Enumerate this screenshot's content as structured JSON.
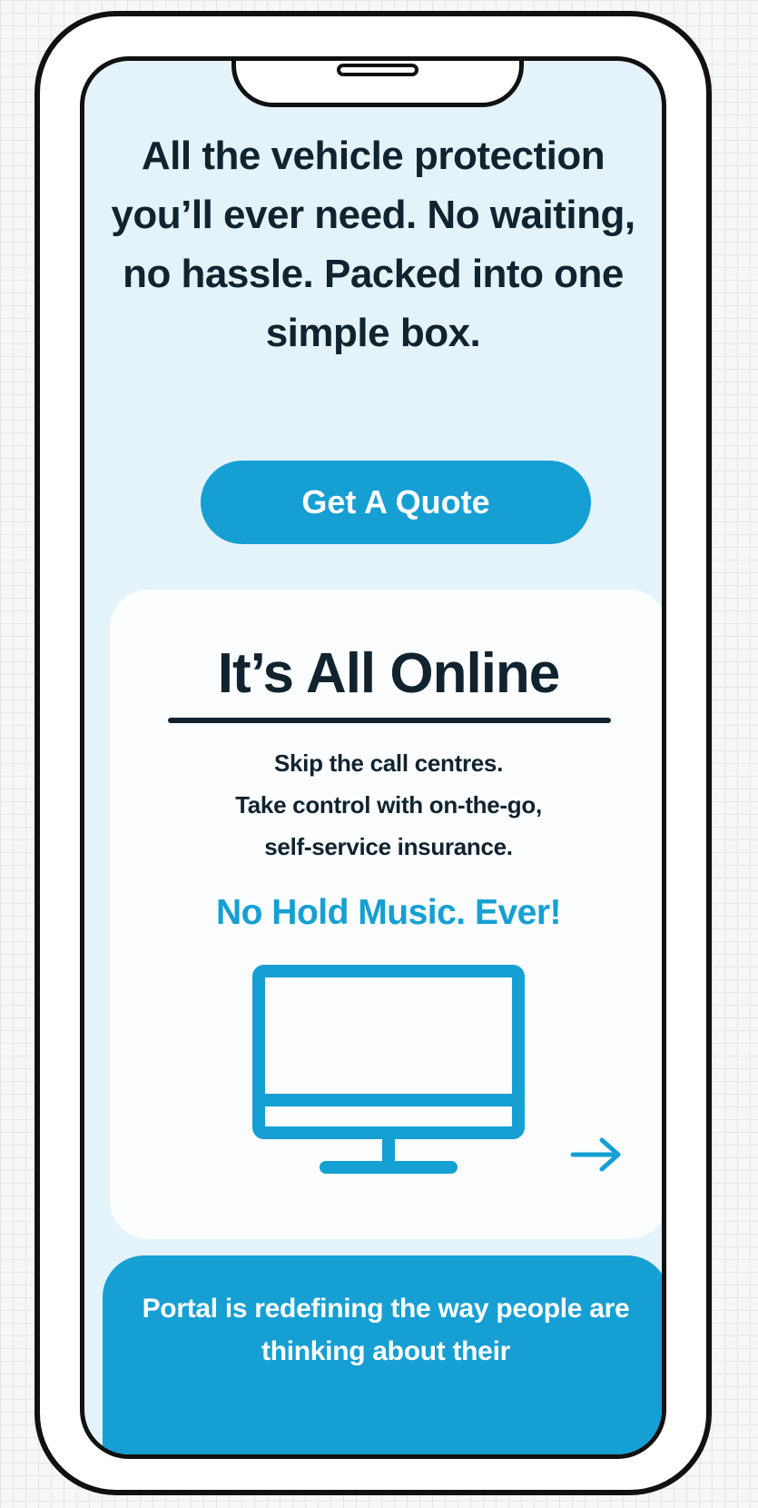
{
  "hero": {
    "headline": "All the vehicle protection you’ll ever need. No waiting, no hassle. Packed into one simple box."
  },
  "cta": {
    "label": "Get A Quote"
  },
  "feature_card": {
    "title": "It’s All Online",
    "description_lines": [
      "Skip the call centres.",
      "Take control with on-the-go,",
      "self-service insurance."
    ],
    "tagline": "No Hold Music. Ever!",
    "icon": "monitor-icon",
    "next_icon": "arrow-right-icon"
  },
  "bottom_card": {
    "text": "Portal is redefining the way people are thinking about their"
  },
  "colors": {
    "accent": "#169fd3",
    "screen_background": "#e3f3f9",
    "text_dark": "#11232e",
    "card_background": "#fbfdfe",
    "frame": "#111111"
  }
}
